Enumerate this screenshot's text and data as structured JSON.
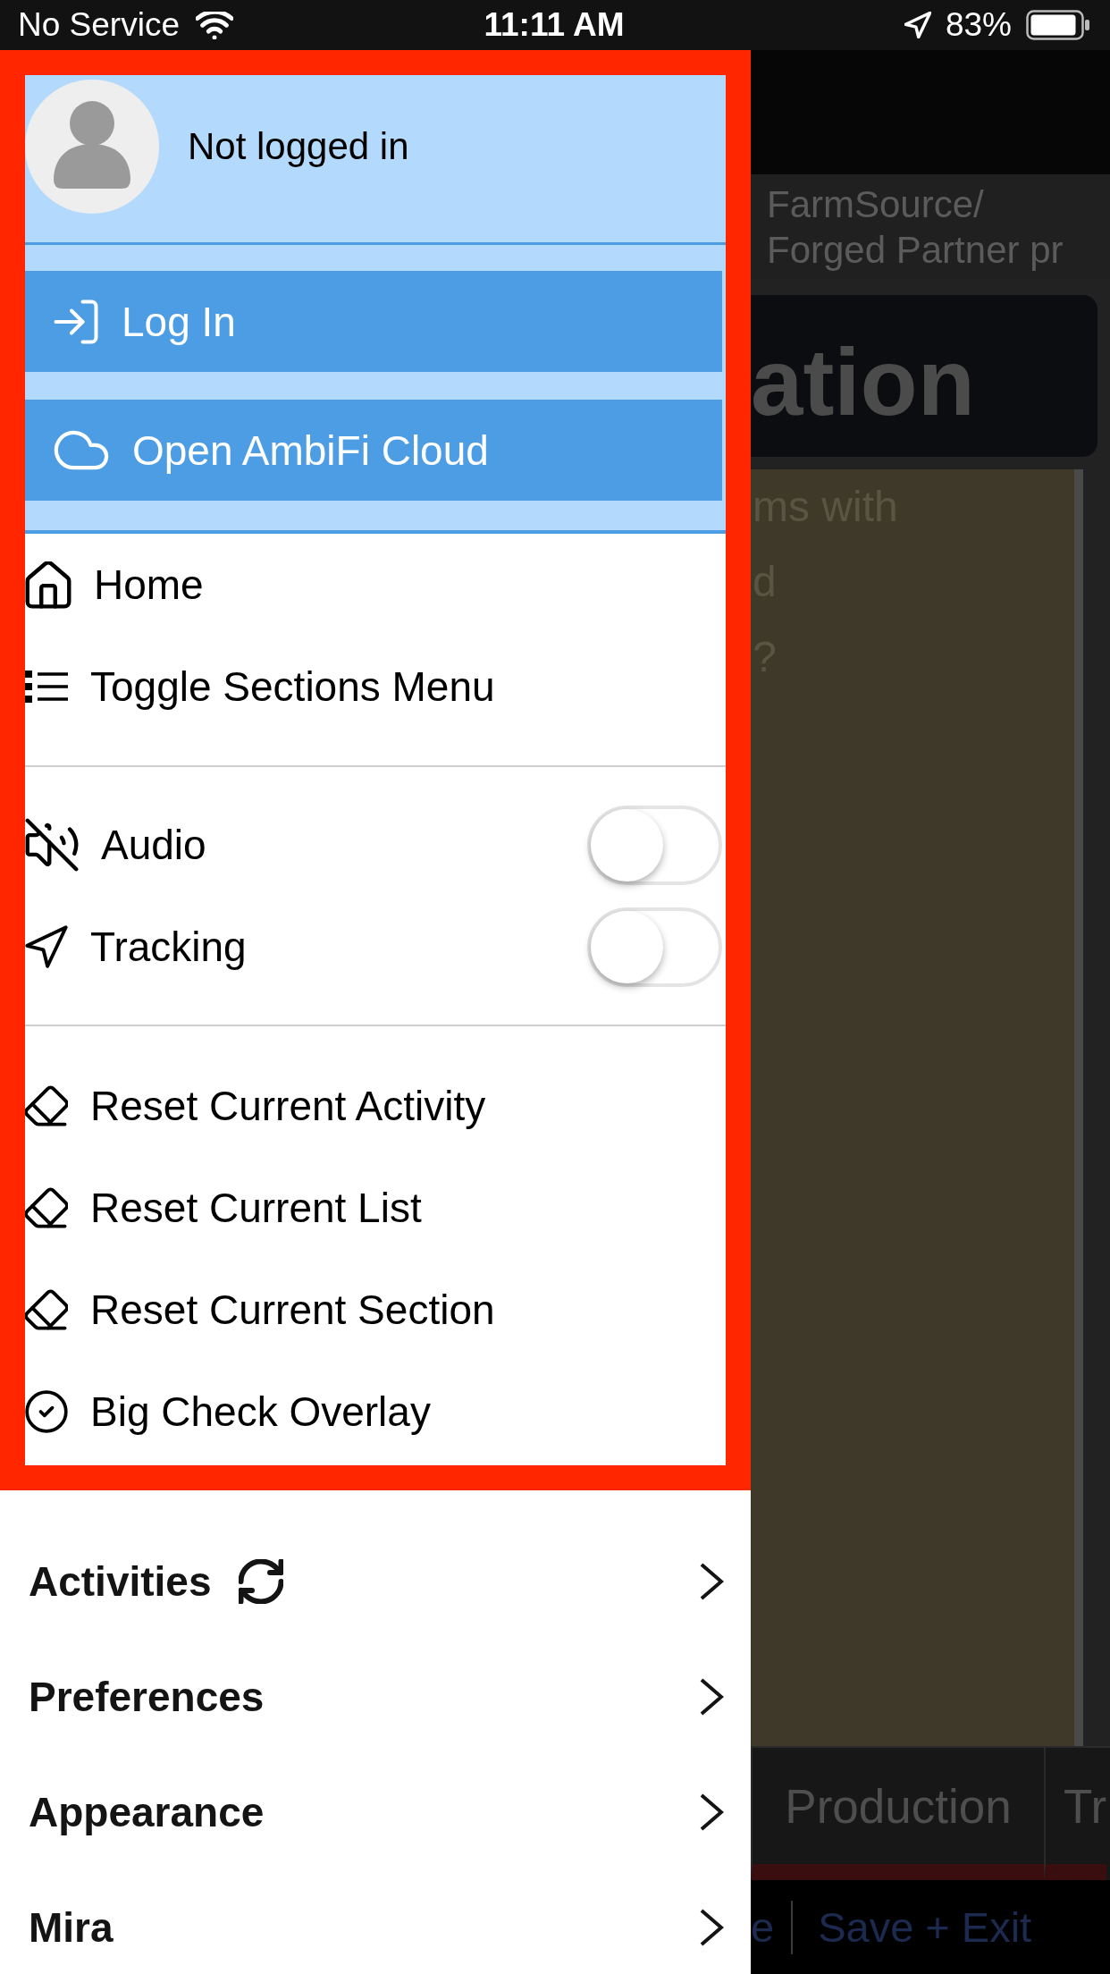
{
  "status_bar": {
    "carrier": "No Service",
    "time": "11:11 AM",
    "battery": "83%"
  },
  "drawer": {
    "profile": {
      "name": "Not logged in"
    },
    "account_buttons": [
      {
        "kind": "login",
        "label": "Log In"
      },
      {
        "kind": "cloud",
        "label": "Open AmbiFi Cloud"
      }
    ],
    "menu_groups": [
      {
        "items": [
          {
            "kind": "home",
            "label": "Home"
          },
          {
            "kind": "sections",
            "label": "Toggle Sections Menu"
          }
        ]
      },
      {
        "items": [
          {
            "kind": "audio",
            "label": "Audio",
            "on": false
          },
          {
            "kind": "tracking",
            "label": "Tracking",
            "on": false
          }
        ]
      },
      {
        "items": [
          {
            "kind": "reset",
            "label": "Reset Current Activity"
          },
          {
            "kind": "reset",
            "label": "Reset Current List"
          },
          {
            "kind": "reset",
            "label": "Reset Current Section"
          },
          {
            "kind": "overlay",
            "label": "Big Check Overlay"
          }
        ]
      }
    ],
    "sections": [
      {
        "kind": "sync",
        "label": "Activities"
      },
      {
        "kind": "plain",
        "label": "Preferences"
      },
      {
        "kind": "plain",
        "label": "Appearance"
      },
      {
        "kind": "plain",
        "label": "Mira"
      }
    ]
  },
  "background": {
    "header_path": [
      "FarmSource/",
      "Forged Partner pr"
    ],
    "title": "ation",
    "question_lines": [
      "ms with",
      "d",
      "?"
    ],
    "tabs": [
      {
        "label": "Production"
      },
      {
        "label": "Tr"
      }
    ],
    "footer_links": [
      "e",
      "Save + Exit"
    ]
  }
}
